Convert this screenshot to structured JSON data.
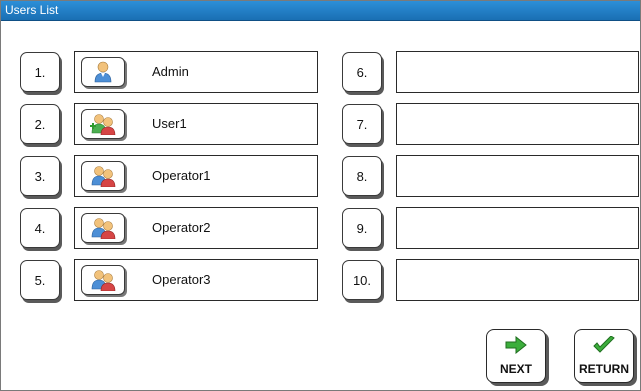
{
  "window": {
    "title": "Users List"
  },
  "users": [
    {
      "number": "1.",
      "name": "Admin",
      "icon": "admin-user-icon"
    },
    {
      "number": "2.",
      "name": "User1",
      "icon": "user-group-add-icon"
    },
    {
      "number": "3.",
      "name": "Operator1",
      "icon": "operator-icon"
    },
    {
      "number": "4.",
      "name": "Operator2",
      "icon": "operator-icon"
    },
    {
      "number": "5.",
      "name": "Operator3",
      "icon": "operator-icon"
    },
    {
      "number": "6.",
      "name": ""
    },
    {
      "number": "7.",
      "name": ""
    },
    {
      "number": "8.",
      "name": ""
    },
    {
      "number": "9.",
      "name": ""
    },
    {
      "number": "10.",
      "name": ""
    }
  ],
  "nav": {
    "next_label": "NEXT",
    "return_label": "RETURN"
  },
  "colors": {
    "titlebar": "#1a6fb3",
    "next_arrow": "#3cae3c",
    "return_check": "#3cae3c"
  }
}
